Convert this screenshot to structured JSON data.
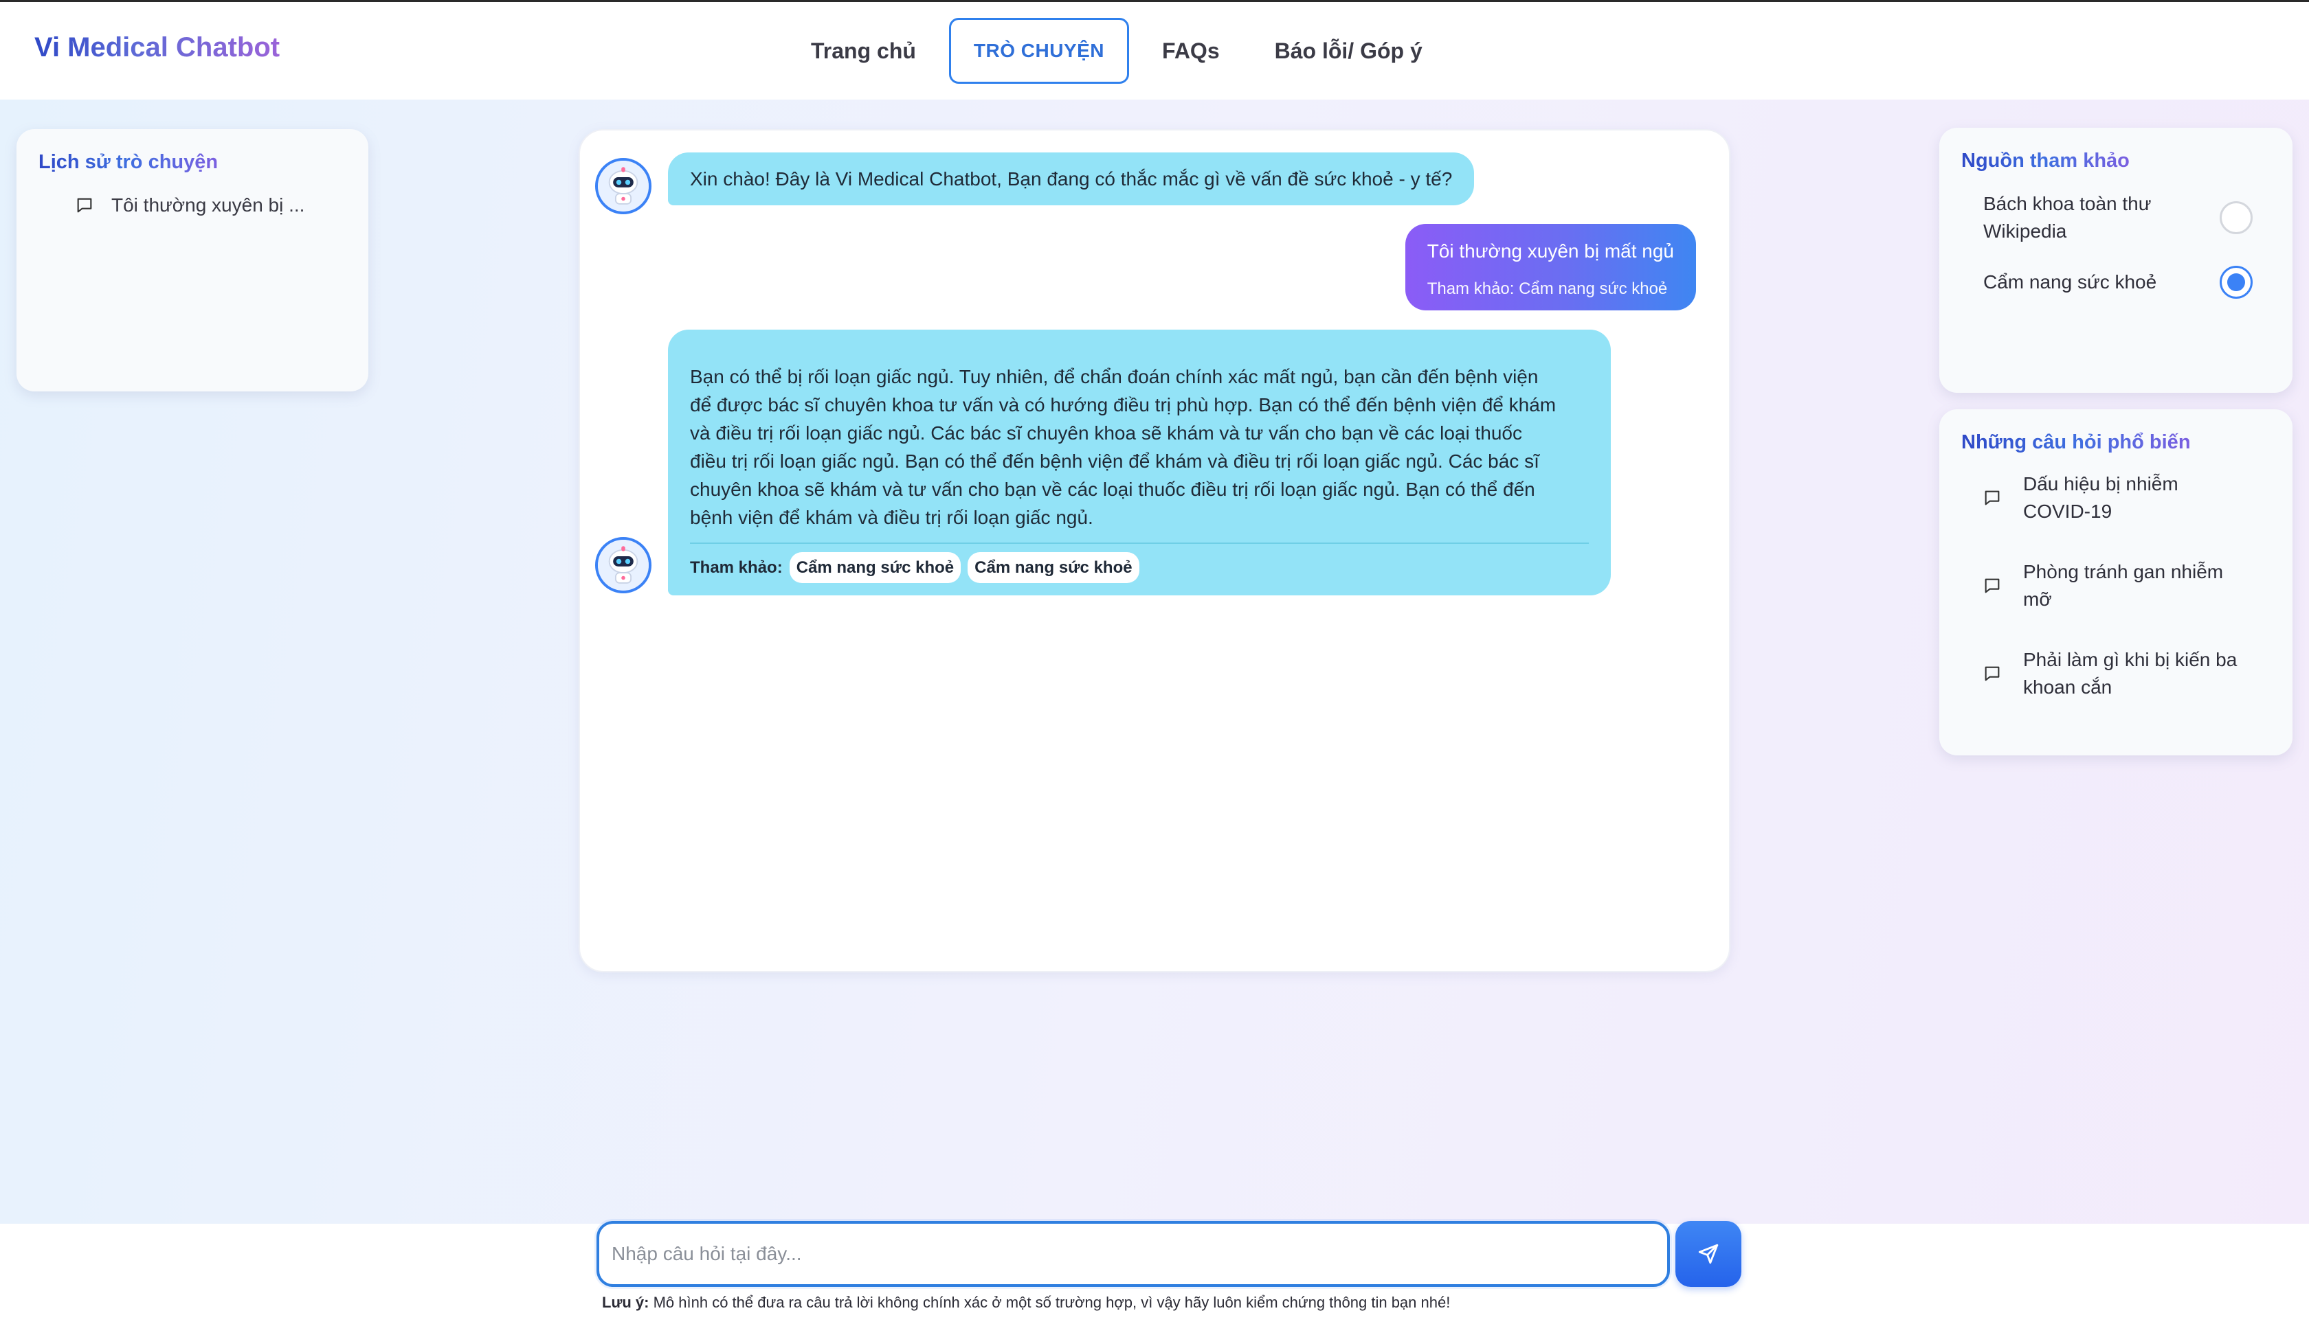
{
  "header": {
    "brand": "Vi Medical Chatbot",
    "nav": [
      "Trang chủ",
      "TRÒ CHUYỆN",
      "FAQs",
      "Báo lỗi/ Góp ý"
    ],
    "active_nav": "TRÒ CHUYỆN"
  },
  "history": {
    "title": "Lịch sử trò chuyện",
    "items": [
      {
        "label": "Tôi thường xuyên bị ..."
      }
    ]
  },
  "sources": {
    "title": "Nguồn tham khảo",
    "options": [
      {
        "label": "Bách khoa toàn thư Wikipedia",
        "selected": false
      },
      {
        "label": "Cẩm nang sức khoẻ",
        "selected": true
      }
    ]
  },
  "popular": {
    "title": "Những câu hỏi phổ biến",
    "items": [
      {
        "label": "Dấu hiệu bị nhiễm COVID-19"
      },
      {
        "label": "Phòng tránh gan nhiễm mỡ"
      },
      {
        "label": "Phải làm gì khi bị kiến ba khoan cắn"
      }
    ]
  },
  "chat": {
    "greeting": "Xin chào! Đây là Vi Medical Chatbot, Bạn đang có thắc mắc gì về vấn đề sức khoẻ - y tế?",
    "user_question": "Tôi thường xuyên bị mất ngủ",
    "user_reference": "Tham khảo: Cẩm nang sức khoẻ",
    "answer_lines": [
      "Bạn có thể bị rối loạn giấc ngủ. Tuy nhiên, để chẩn đoán chính xác mất ngủ, bạn cần đến bệnh viện",
      "để được bác sĩ chuyên khoa tư vấn và có hướng điều trị phù hợp. Bạn có thể đến bệnh viện để khám",
      "và điều trị rối loạn giấc ngủ. Các bác sĩ chuyên khoa sẽ khám và tư vấn cho bạn về các loại thuốc",
      "điều trị rối loạn giấc ngủ. Bạn có thể đến bệnh viện để khám và điều trị rối loạn giấc ngủ. Các bác sĩ",
      "chuyên khoa sẽ khám và tư vấn cho bạn về các loại thuốc điều trị rối loạn giấc ngủ. Bạn có thể đến",
      "bệnh viện để khám và điều trị rối loạn giấc ngủ."
    ],
    "answer_ref_label": "Tham khảo:",
    "answer_refs": [
      "Cẩm nang sức khoẻ",
      "Cẩm nang sức khoẻ"
    ]
  },
  "input": {
    "placeholder": "Nhập câu hỏi tại đây...",
    "value": ""
  },
  "note": {
    "label": "Lưu ý:",
    "text": " Mô hình có thể đưa ra câu trả lời không chính xác ở một số trường hợp, vì vậy hãy luôn kiểm chứng thông tin bạn nhé!"
  },
  "colors": {
    "accent": "#3b82f6",
    "bot_bubble": "#93e3f7",
    "user_bubble_start": "#8b5cf6",
    "user_bubble_end": "#3f86f2"
  },
  "icons": [
    "chat-bubble-icon",
    "send-icon",
    "robot-avatar-icon"
  ]
}
